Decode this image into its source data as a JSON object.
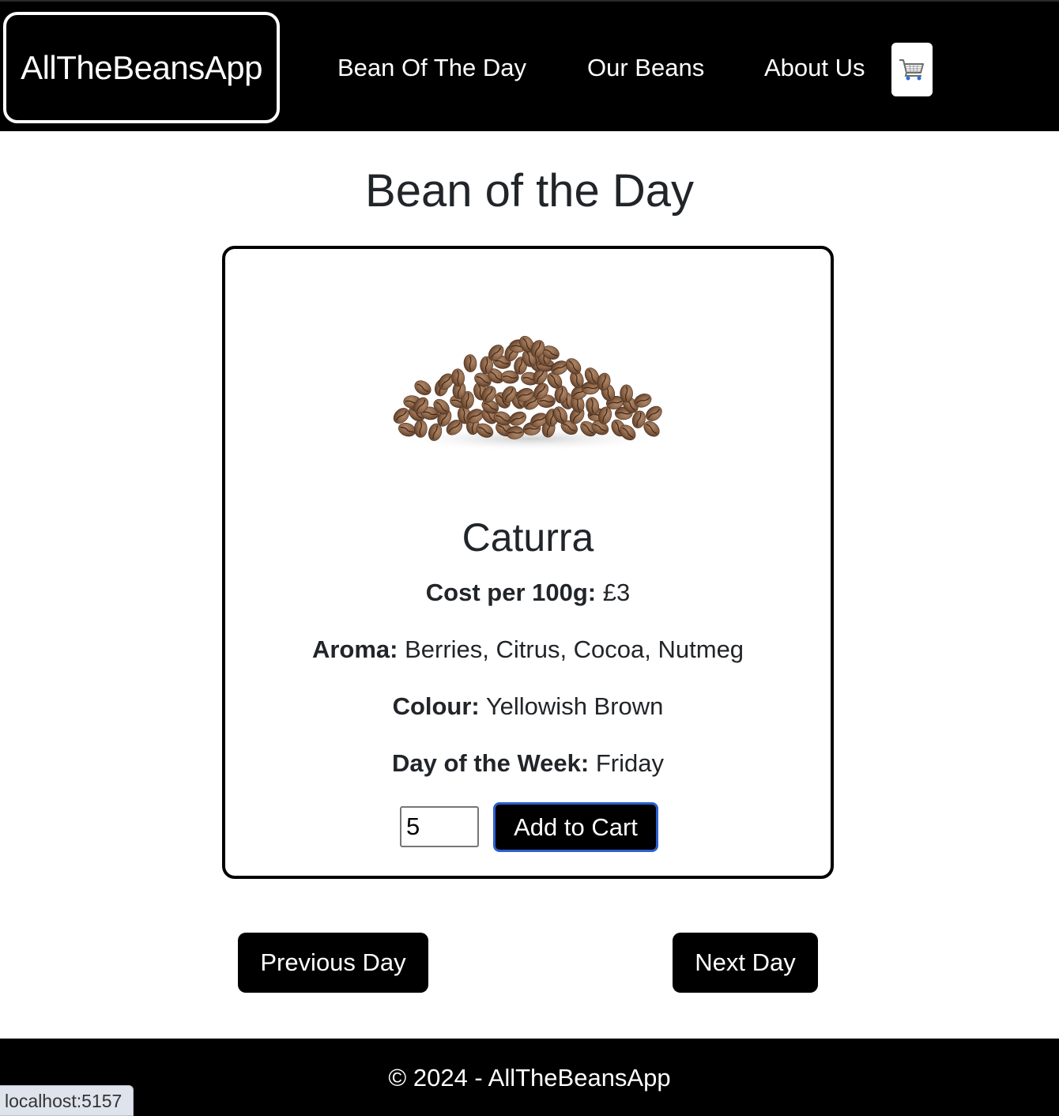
{
  "nav": {
    "brand": "AllTheBeansApp",
    "links": [
      "Bean Of The Day",
      "Our Beans",
      "About Us"
    ],
    "cart_icon": "shopping-cart-icon"
  },
  "page": {
    "title": "Bean of the Day"
  },
  "bean": {
    "image_icon": "coffee-beans-image",
    "name": "Caturra",
    "cost_label": "Cost per 100g:",
    "cost_value": "£3",
    "aroma_label": "Aroma:",
    "aroma_value": "Berries, Citrus, Cocoa, Nutmeg",
    "colour_label": "Colour:",
    "colour_value": "Yellowish Brown",
    "day_label": "Day of the Week:",
    "day_value": "Friday",
    "quantity": "5",
    "add_to_cart_label": "Add to Cart"
  },
  "pagination": {
    "previous_label": "Previous Day",
    "next_label": "Next Day"
  },
  "footer": {
    "text": "© 2024 - AllTheBeansApp"
  },
  "status_bar": {
    "url": "localhost:5157"
  },
  "colors": {
    "nav_background": "#000000",
    "button_background": "#000000",
    "focus_ring": "#2c5fcf",
    "text": "#212529"
  }
}
